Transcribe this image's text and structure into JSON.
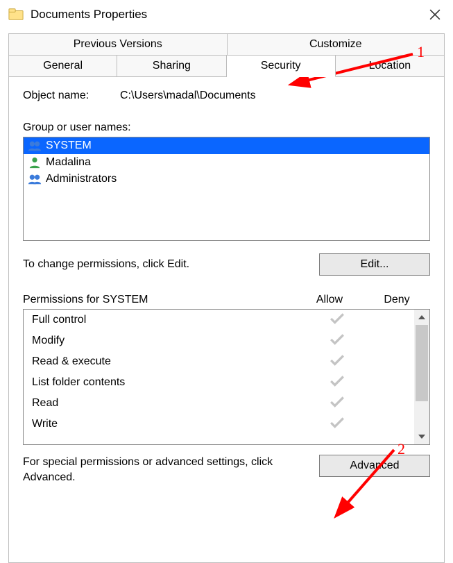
{
  "title": "Documents Properties",
  "tabs_top": [
    "Previous Versions",
    "Customize"
  ],
  "tabs_bottom": [
    "General",
    "Sharing",
    "Security",
    "Location"
  ],
  "object_name_label": "Object name:",
  "object_name_value": "C:\\Users\\madal\\Documents",
  "group_label": "Group or user names:",
  "users": [
    {
      "name": "SYSTEM",
      "icon": "group",
      "selected": true
    },
    {
      "name": "Madalina",
      "icon": "user",
      "selected": false
    },
    {
      "name": "Administrators",
      "icon": "group",
      "selected": false
    }
  ],
  "change_text": "To change permissions, click Edit.",
  "edit_button": "Edit...",
  "perm_header": "Permissions for SYSTEM",
  "allow_label": "Allow",
  "deny_label": "Deny",
  "permissions": [
    {
      "name": "Full control",
      "allow": true
    },
    {
      "name": "Modify",
      "allow": true
    },
    {
      "name": "Read & execute",
      "allow": true
    },
    {
      "name": "List folder contents",
      "allow": true
    },
    {
      "name": "Read",
      "allow": true
    },
    {
      "name": "Write",
      "allow": true
    }
  ],
  "advanced_text": "For special permissions or advanced settings, click Advanced.",
  "advanced_button": "Advanced",
  "annotations": {
    "one": "1",
    "two": "2"
  }
}
